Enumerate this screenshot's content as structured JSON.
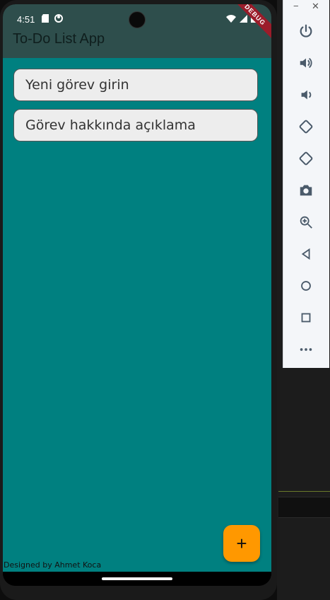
{
  "status_bar": {
    "time": "4:51"
  },
  "app_bar": {
    "title": "To-Do List App",
    "debug_label": "DEBUG"
  },
  "form": {
    "task_placeholder": "Yeni görev girin",
    "description_placeholder": "Görev hakkında açıklama"
  },
  "fab": {
    "label": "+"
  },
  "footer": {
    "credit": "Designed by Ahmet Koca"
  },
  "emulator_panel": {
    "minimize_label": "−",
    "close_label": "✕"
  },
  "colors": {
    "app_bar_bg": "#2e4e4c",
    "body_bg": "#008080",
    "fab_bg": "#ff9800",
    "debug_banner": "#9b1c2a"
  }
}
